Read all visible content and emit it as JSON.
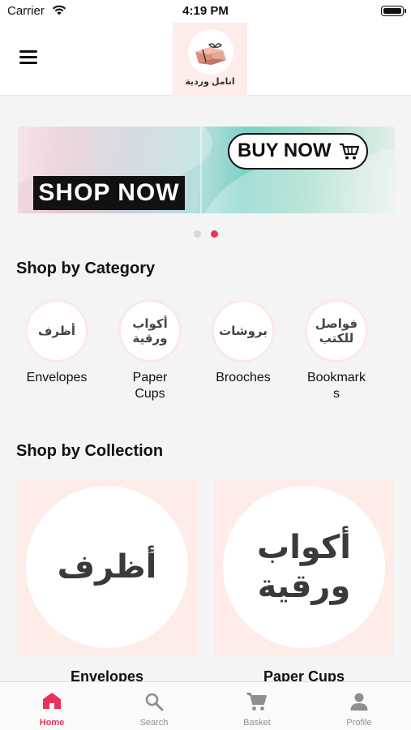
{
  "status_bar": {
    "carrier": "Carrier",
    "time": "4:19 PM"
  },
  "header": {
    "logo_text": "انامل وردية",
    "menu_icon": "hamburger-icon"
  },
  "banner": {
    "shop_now_label": "SHOP NOW",
    "buy_now_label": "BUY NOW",
    "active_slide": 2,
    "slide_count": 2
  },
  "categories": {
    "title": "Shop by Category",
    "items": [
      {
        "circle_text": "أظرف",
        "label": "Envelopes"
      },
      {
        "circle_text": "أكواب ورقية",
        "label": "Paper Cups"
      },
      {
        "circle_text": "بروشات",
        "label": "Brooches"
      },
      {
        "circle_text": "فواصل للكتب",
        "label": "Bookmarks"
      }
    ]
  },
  "collections": {
    "title": "Shop by Collection",
    "items": [
      {
        "circle_text": "أظرف",
        "label": "Envelopes"
      },
      {
        "circle_text": "أكواب ورقية",
        "label": "Paper Cups"
      }
    ]
  },
  "tab_bar": {
    "tabs": [
      {
        "label": "Home",
        "icon": "home-icon",
        "active": true
      },
      {
        "label": "Search",
        "icon": "search-icon",
        "active": false
      },
      {
        "label": "Basket",
        "icon": "cart-icon",
        "active": false
      },
      {
        "label": "Profile",
        "icon": "profile-icon",
        "active": false
      }
    ],
    "active_color": "#e8345a",
    "inactive_color": "#8f8f8f"
  }
}
